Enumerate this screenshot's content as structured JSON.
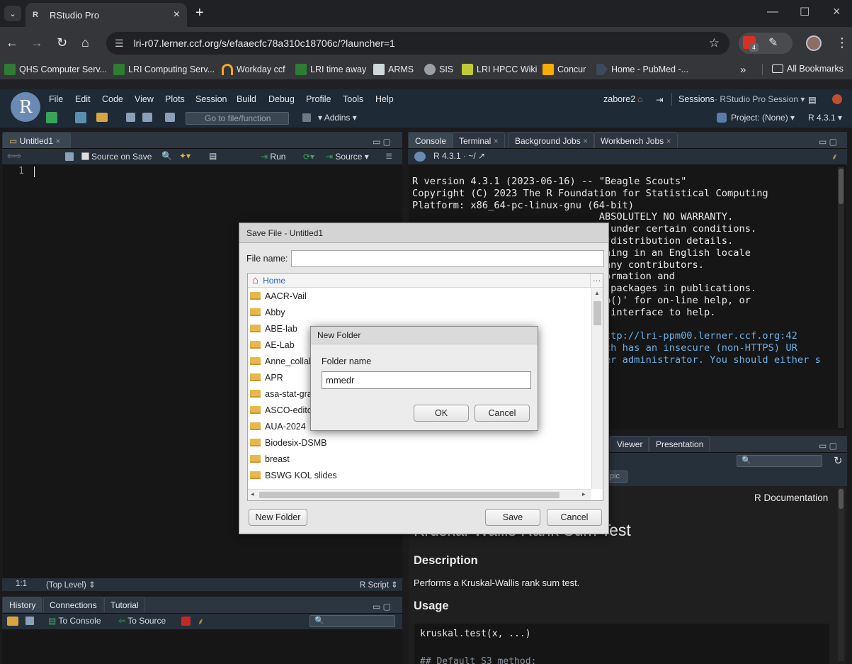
{
  "browser": {
    "tab_title": "RStudio Pro",
    "tab_favicon": "R",
    "url": "lri-r07.lerner.ccf.org/s/efaaecfc78a310c18706c/?launcher=1",
    "badge_count": "4",
    "bookmarks": [
      "QHS Computer Serv...",
      "LRI Computing Serv...",
      "Workday ccf",
      "LRI time away",
      "ARMS",
      "SIS",
      "LRI HPCC Wiki",
      "Concur",
      "Home - PubMed -..."
    ],
    "all_bookmarks": "All Bookmarks",
    "accent": "#8ab4f8"
  },
  "rstudio": {
    "menus": [
      "File",
      "Edit",
      "Code",
      "View",
      "Plots",
      "Session",
      "Build",
      "Debug",
      "Profile",
      "Tools",
      "Help"
    ],
    "user": "zabore2",
    "sessions_label": "Sessions",
    "session_name": "RStudio Pro Session",
    "goto_placeholder": "Go to file/function",
    "addins": "Addins",
    "project": "Project: (None)",
    "r_version": "R 4.3.1",
    "source_pane": {
      "tab": "Untitled1",
      "source_on_save": "Source on Save",
      "run": "Run",
      "source": "Source",
      "line_number": "1",
      "cursor_pos": "1:1",
      "scope": "(Top Level)",
      "file_type": "R Script"
    },
    "console_pane": {
      "tabs": [
        "Console",
        "Terminal",
        "Background Jobs",
        "Workbench Jobs"
      ],
      "path_label": "R 4.3.1 · ~/",
      "lines": [
        "R version 4.3.1 (2023-06-16) -- \"Beagle Scouts\"",
        "Copyright (C) 2023 The R Foundation for Statistical Computing",
        "Platform: x86_64-pc-linux-gnu (64-bit)",
        "",
        "                                ABSOLUTELY NO WARRANTY.",
        "                                t under certain conditions.",
        "                                r distribution details.",
        "",
        "                                nning in an English locale",
        "",
        "                                many contributors.",
        "                                formation and",
        "                                R packages in publications.",
        "",
        "                                lp()' for on-line help, or",
        "                                r interface to help."
      ],
      "link_lines": [
        "                            to \"http://lri-ppm00.lerner.ccf.org:42",
        "                              which has an insecure (non-HTTPS) UR",
        "                                ver administrator. You should either s"
      ]
    },
    "help_pane": {
      "tabs": [
        "Viewer",
        "Presentation"
      ],
      "topic_btn": "pic",
      "r_documentation": "R Documentation",
      "title": "Kruskal-Wallis Rank Sum Test",
      "description_heading": "Description",
      "description": "Performs a Kruskal-Wallis rank sum test.",
      "usage_heading": "Usage",
      "usage_code_1": "kruskal.test(x, ...)",
      "usage_code_2": "## Default S3 method:"
    },
    "history_pane": {
      "tabs": [
        "History",
        "Connections",
        "Tutorial"
      ],
      "to_console": "To Console",
      "to_source": "To Source"
    }
  },
  "save_dialog": {
    "title": "Save File - Untitled1",
    "file_name_label": "File name:",
    "file_name_value": "",
    "breadcrumb": "Home",
    "folders": [
      "AACR-Vail",
      "Abby",
      "ABE-lab",
      "AE-Lab",
      "Anne_collab",
      "APR",
      "asa-stat-gra",
      "ASCO-editor",
      "AUA-2024",
      "Biodesix-DSMB",
      "breast",
      "BSWG KOL slides"
    ],
    "new_folder_btn": "New Folder",
    "save_btn": "Save",
    "cancel_btn": "Cancel"
  },
  "new_folder_dialog": {
    "title": "New Folder",
    "label": "Folder name",
    "value": "mmedr",
    "ok": "OK",
    "cancel": "Cancel"
  }
}
